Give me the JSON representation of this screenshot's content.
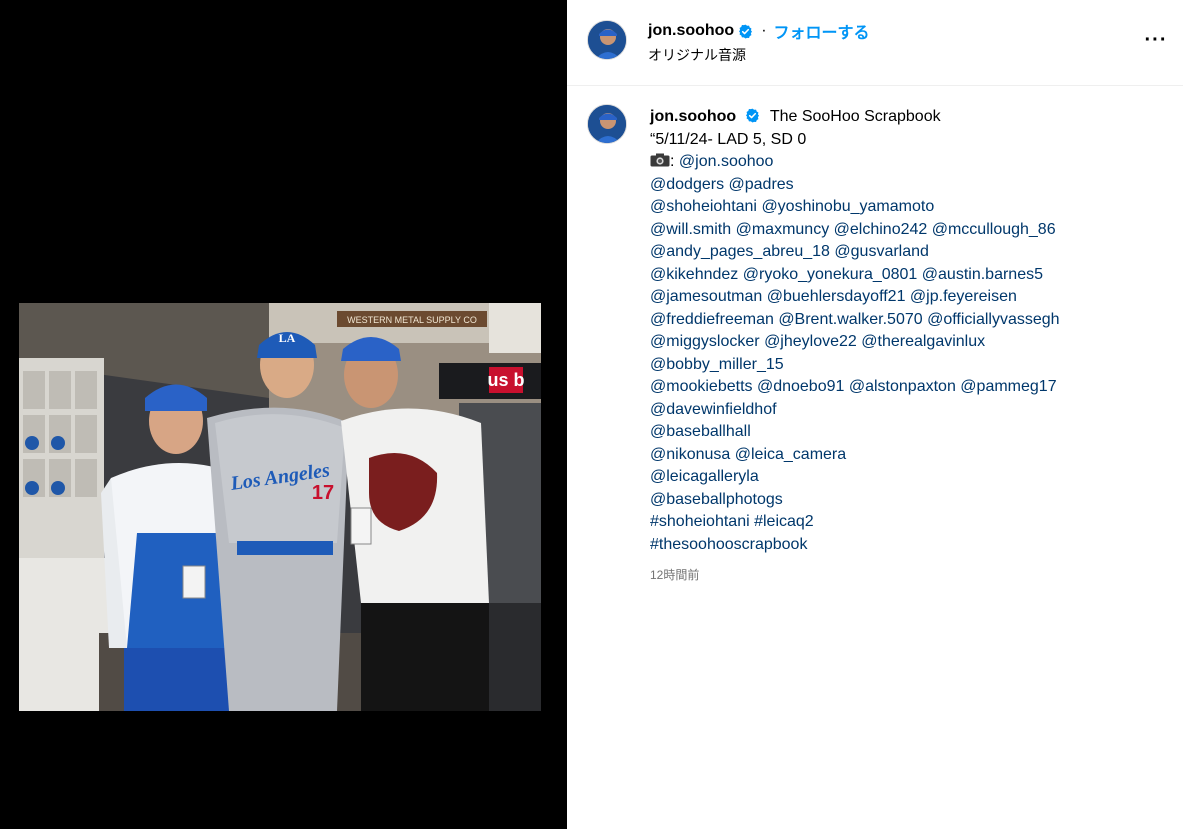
{
  "header": {
    "username": "jon.soohoo",
    "separator": "·",
    "follow_label": "フォローする",
    "subtitle": "オリジナル音源",
    "more_label": "···"
  },
  "caption": {
    "username": "jon.soohoo",
    "title": "The SooHoo Scrapbook",
    "line1": "“5/11/24- LAD 5, SD 0",
    "camera_suffix": ":",
    "lines": [
      [
        "@jon.soohoo"
      ],
      [
        "@dodgers",
        "@padres"
      ],
      [
        "@shoheiohtani",
        "@yoshinobu_yamamoto"
      ],
      [
        "@will.smith",
        "@maxmuncy",
        "@elchino242",
        "@mccullough_86"
      ],
      [
        "@andy_pages_abreu_18",
        "@gusvarland"
      ],
      [
        "@kikehndez",
        "@ryoko_yonekura_0801",
        "@austin.barnes5"
      ],
      [
        "@jamesoutman",
        "@buehlersdayoff21",
        "@jp.feyereisen"
      ],
      [
        "@freddiefreeman",
        "@Brent.walker.5070",
        "@officiallyvassegh"
      ],
      [
        "@miggyslocker",
        "@jheylove22",
        "@therealgavinlux"
      ],
      [
        "@bobby_miller_15"
      ],
      [
        "@mookiebetts",
        "@dnoebo91",
        "@alstonpaxton",
        "@pammeg17"
      ],
      [
        "@davewinfieldhof"
      ],
      [
        "@baseballhall"
      ],
      [
        "@nikonusa",
        "@leica_camera"
      ],
      [
        "@leicagalleryla"
      ],
      [
        "@baseballphotogs"
      ],
      [
        "#shoheiohtani",
        "#leicaq2"
      ],
      [
        "#thesoohooscrapbook"
      ]
    ],
    "timestamp": "12時間前"
  },
  "photo": {
    "jersey_text": "Los Angeles",
    "jersey_number": "17",
    "cap_logo": "LA",
    "sign_text": "us b",
    "banner_text": "WESTERN METAL SUPPLY CO"
  },
  "colors": {
    "follow_blue": "#0095f6",
    "link_navy": "#00376b",
    "verified_blue": "#0095f6",
    "muted": "#737373",
    "dodger_blue": "#1e5bb8"
  },
  "icons": {
    "verified": "verified-badge-icon",
    "camera": "camera-icon",
    "more": "more-options-icon"
  }
}
